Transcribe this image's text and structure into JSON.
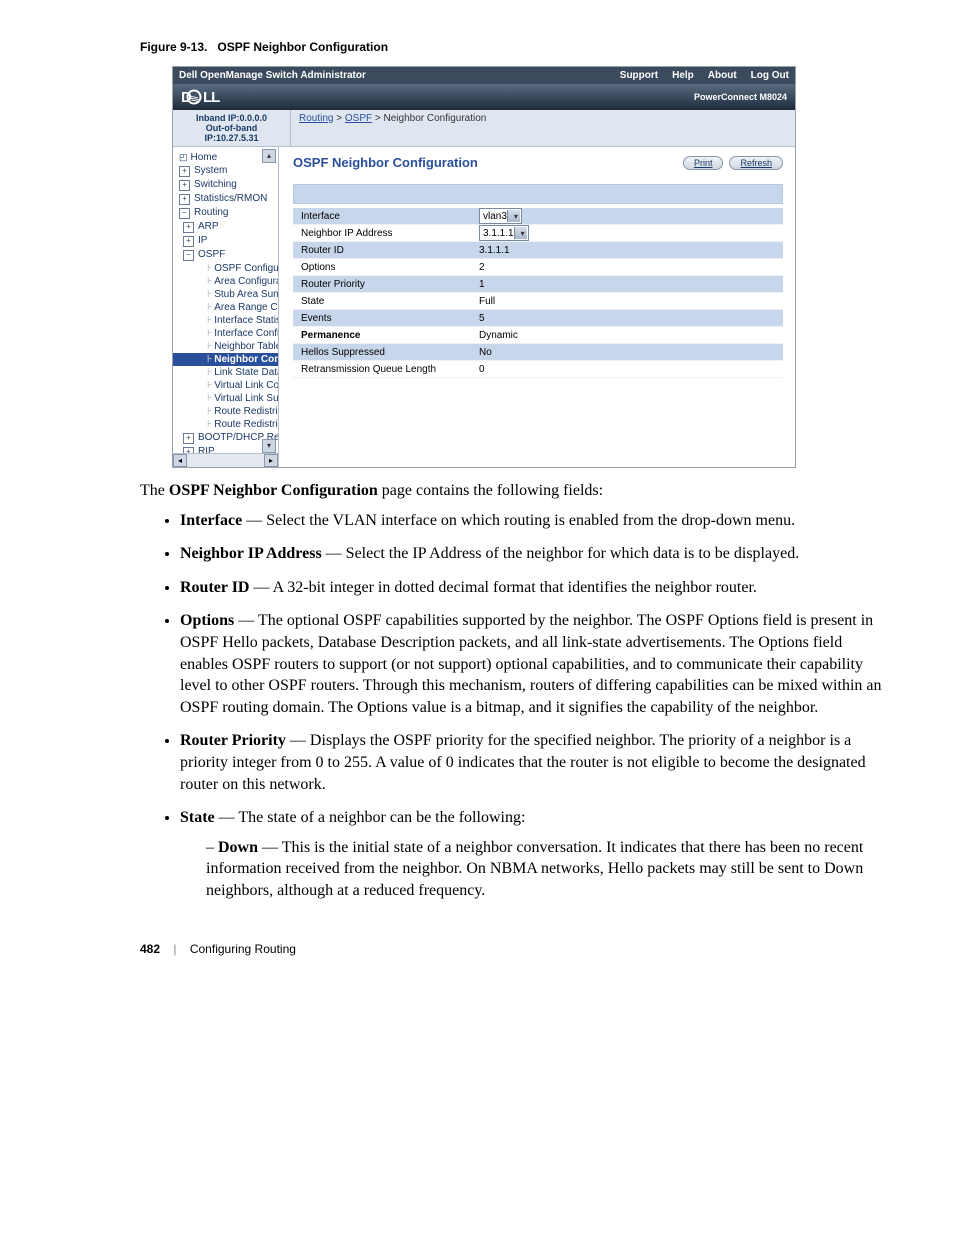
{
  "figure_caption_prefix": "Figure 9-13.",
  "figure_caption_title": "OSPF Neighbor Configuration",
  "titlebar": {
    "title": "Dell OpenManage Switch Administrator",
    "nav": [
      "Support",
      "Help",
      "About",
      "Log Out"
    ]
  },
  "logo_text": "DELL",
  "product_name": "PowerConnect M8024",
  "ip_info": {
    "inband": "Inband IP:0.0.0.0",
    "oob": "Out-of-band IP:10.27.5.31"
  },
  "breadcrumb": {
    "a": "Routing",
    "b": "OSPF",
    "c": "Neighbor Configuration"
  },
  "page_heading": "OSPF Neighbor Configuration",
  "buttons": {
    "print": "Print",
    "refresh": "Refresh"
  },
  "tree": {
    "home": "Home",
    "system": "System",
    "switching": "Switching",
    "stats": "Statistics/RMON",
    "routing": "Routing",
    "arp": "ARP",
    "ip": "IP",
    "ospf": "OSPF",
    "ospf_items": [
      "OSPF Configuratio",
      "Area Configuration",
      "Stub Area Summa",
      "Area Range Config",
      "Interface Statistics",
      "Interface Configura",
      "Neighbor Table",
      "Neighbor Configu",
      "Link State Databa",
      "Virtual Link Config",
      "Virtual Link Summ",
      "Route Redistributio",
      "Route Redistributio"
    ],
    "bootp": "BOOTP/DHCP Relay",
    "rip": "RIP"
  },
  "config": {
    "rows": [
      {
        "label": "Interface",
        "value": "vlan3",
        "select": true
      },
      {
        "label": "Neighbor IP Address",
        "value": "3.1.1.1",
        "select": true
      },
      {
        "label": "Router ID",
        "value": "3.1.1.1"
      },
      {
        "label": "Options",
        "value": "2"
      },
      {
        "label": "Router Priority",
        "value": "1"
      },
      {
        "label": "State",
        "value": "Full"
      },
      {
        "label": "Events",
        "value": "5"
      },
      {
        "label": "Permanence",
        "value": "Dynamic",
        "bold": true
      },
      {
        "label": "Hellos Suppressed",
        "value": "No"
      },
      {
        "label": "Retransmission Queue Length",
        "value": "0"
      }
    ]
  },
  "doc": {
    "intro_a": "The ",
    "intro_b": "OSPF Neighbor Configuration",
    "intro_c": " page contains the following fields:",
    "items": [
      {
        "term": "Interface",
        "desc": " — Select the VLAN interface on which routing is enabled from the drop-down menu."
      },
      {
        "term": "Neighbor IP Address",
        "desc": " — Select the IP Address of the neighbor for which data is to be displayed."
      },
      {
        "term": "Router ID",
        "desc": " — A 32-bit integer in dotted decimal format that identifies the neighbor router."
      },
      {
        "term": "Options",
        "desc": " — The optional OSPF capabilities supported by the neighbor. The OSPF Options field is present in OSPF Hello packets, Database Description packets, and all link-state advertisements. The Options field enables OSPF routers to support (or not support) optional capabilities, and to communicate their capability level to other OSPF routers. Through this mechanism, routers of differing capabilities can be mixed within an OSPF routing domain. The Options value is a bitmap, and it signifies the capability of the neighbor."
      },
      {
        "term": "Router Priority",
        "desc": " — Displays the OSPF priority for the specified neighbor. The priority of a neighbor is a priority integer from 0 to 255. A value of 0 indicates that the router is not eligible to become the designated router on this network."
      },
      {
        "term": "State",
        "desc": " — The state of a neighbor can be the following:"
      }
    ],
    "state_sub": {
      "term": "Down",
      "desc": " — This is the initial state of a neighbor conversation. It indicates that there has been no recent information received from the neighbor. On NBMA networks, Hello packets may still be sent to Down neighbors, although at a reduced frequency."
    },
    "footer": {
      "page": "482",
      "section": "Configuring Routing"
    }
  }
}
